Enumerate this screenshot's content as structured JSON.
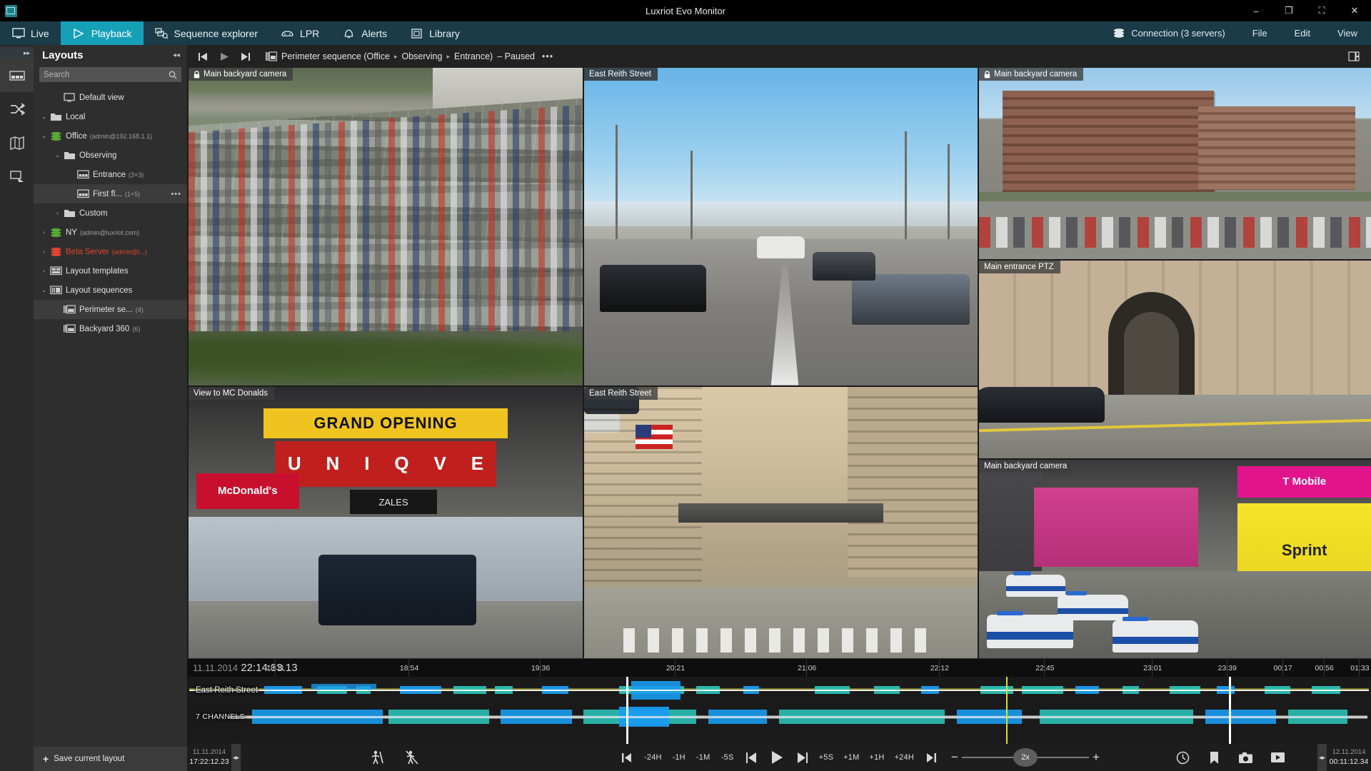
{
  "window": {
    "title": "Luxriot Evo Monitor",
    "app_icon": "monitor-icon",
    "minimize": "–",
    "restore": "❐",
    "maximize": "⛶",
    "close": "✕"
  },
  "menubar": {
    "tabs": [
      {
        "label": "Live",
        "icon": "monitor-icon",
        "active": false
      },
      {
        "label": "Playback",
        "icon": "play-triangle-icon",
        "active": true
      },
      {
        "label": "Sequence explorer",
        "icon": "sequence-icon",
        "active": false
      },
      {
        "label": "LPR",
        "icon": "car-plate-icon",
        "active": false
      },
      {
        "label": "Alerts",
        "icon": "bell-icon",
        "active": false
      },
      {
        "label": "Library",
        "icon": "library-icon",
        "active": false
      }
    ],
    "right": [
      {
        "label": "Connection (3 servers)",
        "icon": "database-stack-icon"
      },
      {
        "label": "File",
        "icon": ""
      },
      {
        "label": "Edit",
        "icon": ""
      },
      {
        "label": "View",
        "icon": ""
      }
    ]
  },
  "rail": {
    "collapse": "▸▸",
    "items": [
      {
        "name": "layouts-icon",
        "selected": true
      },
      {
        "name": "sequences-icon",
        "selected": false
      },
      {
        "name": "maps-icon",
        "selected": false
      },
      {
        "name": "screens-icon",
        "selected": false
      }
    ]
  },
  "layouts_panel": {
    "title": "Layouts",
    "collapse_icon": "◂◂",
    "search": {
      "placeholder": "Search",
      "value": "",
      "icon": "search-icon"
    },
    "save_button": {
      "label": "Save current layout",
      "plus": "+"
    },
    "tree": [
      {
        "indent": 1,
        "arrow": "",
        "icon": "monitor-icon",
        "label": "Default view",
        "sub": "",
        "selected": false,
        "red": false,
        "dots": false
      },
      {
        "indent": 0,
        "arrow": "⌄",
        "icon": "folder-icon",
        "label": "Local",
        "sub": "",
        "selected": false,
        "red": false,
        "dots": false
      },
      {
        "indent": 0,
        "arrow": "⌄",
        "icon": "server-green-icon",
        "label": "Office",
        "sub": "(admin@192.168.1.1)",
        "selected": false,
        "red": false,
        "dots": false
      },
      {
        "indent": 1,
        "arrow": "⌄",
        "icon": "folder-icon",
        "label": "Observing",
        "sub": "",
        "selected": false,
        "red": false,
        "dots": false
      },
      {
        "indent": 2,
        "arrow": "",
        "icon": "layout-icon",
        "label": "Entrance",
        "sub": "(3×3)",
        "selected": false,
        "red": false,
        "dots": false
      },
      {
        "indent": 2,
        "arrow": "",
        "icon": "layout-icon",
        "label": "First fl...",
        "sub": "(1+5)",
        "selected": true,
        "red": false,
        "dots": true
      },
      {
        "indent": 1,
        "arrow": "›",
        "icon": "folder-icon",
        "label": "Custom",
        "sub": "",
        "selected": false,
        "red": false,
        "dots": false
      },
      {
        "indent": 0,
        "arrow": "›",
        "icon": "server-green-icon",
        "label": "NY",
        "sub": "(admin@luxriot.com)",
        "selected": false,
        "red": false,
        "dots": false
      },
      {
        "indent": 0,
        "arrow": "›",
        "icon": "server-red-icon",
        "label": "Beta Server",
        "sub": "(admin@l...)",
        "selected": false,
        "red": true,
        "dots": false
      },
      {
        "indent": 0,
        "arrow": "›",
        "icon": "template-icon",
        "label": "Layout templates",
        "sub": "",
        "selected": false,
        "red": false,
        "dots": false
      },
      {
        "indent": 0,
        "arrow": "⌄",
        "icon": "sequence-list-icon",
        "label": "Layout sequences",
        "sub": "",
        "selected": false,
        "red": false,
        "dots": false
      },
      {
        "indent": 1,
        "arrow": "",
        "icon": "seq-item-icon",
        "label": "Perimeter se...",
        "sub": "(4)",
        "selected": true,
        "red": false,
        "dots": false
      },
      {
        "indent": 1,
        "arrow": "",
        "icon": "seq-item-icon",
        "label": "Backyard 360",
        "sub": "(6)",
        "selected": false,
        "red": false,
        "dots": false
      }
    ]
  },
  "toolbar": {
    "prev_icon": "skip-previous-icon",
    "play_icon": "play-icon",
    "next_icon": "skip-next-icon",
    "breadcrumb": {
      "icon": "sequence-layout-icon",
      "root": "Perimeter sequence (Office",
      "sep": "▸",
      "parts": [
        "Observing",
        "Entrance)"
      ],
      "state": "– Paused",
      "overflow": "•••"
    },
    "right_icon": "grid-expand-icon"
  },
  "cells": [
    {
      "title": "Main backyard camera",
      "locked": true,
      "selected": false,
      "scene": "parking"
    },
    {
      "title": "View to MC Donalds",
      "locked": false,
      "selected": false,
      "scene": "mcd"
    },
    {
      "title": "East Reith Street",
      "locked": false,
      "selected": true,
      "scene": "street"
    },
    {
      "title": "East Reith Street",
      "locked": false,
      "selected": false,
      "scene": "city"
    },
    {
      "title": "Main backyard camera",
      "locked": true,
      "selected": false,
      "scene": "office"
    },
    {
      "title": "Main entrance PTZ",
      "locked": false,
      "selected": false,
      "scene": "arch"
    },
    {
      "title": "Main backyard camera",
      "locked": false,
      "selected": false,
      "scene": "mall"
    }
  ],
  "timeline": {
    "current_date": "11.11.2014",
    "current_time": "22:14:33.13",
    "ticks": [
      "18:11",
      "18:54",
      "19:36",
      "20:21",
      "21:06",
      "22:12",
      "22:45",
      "23:01",
      "23:39",
      "00:17",
      "00:56",
      "01:33"
    ],
    "tracks": [
      {
        "name": "East Reith Street",
        "small": false
      },
      {
        "name": "7 CHANNELS",
        "small": true
      }
    ],
    "colors": {
      "archive": "#1a9cf0",
      "motion": "#2bc0b6",
      "audio": "#8c8a2a",
      "playhead": "#d9e021",
      "now": "#ffffff"
    }
  },
  "bottom": {
    "left_timestamp": {
      "date": "11.11.2014",
      "time": "17:22:12.23"
    },
    "right_timestamp": {
      "date": "12.11.2014",
      "time": "00:11:12.34"
    },
    "grip_icon": "drag-handle-icon",
    "filters": [
      {
        "name": "motion-filter-icon"
      },
      {
        "name": "motion-filter-off-icon"
      }
    ],
    "transport": [
      {
        "label": "",
        "icon": "jump-start-icon"
      },
      {
        "label": "-24H",
        "icon": ""
      },
      {
        "label": "-1H",
        "icon": ""
      },
      {
        "label": "-1M",
        "icon": ""
      },
      {
        "label": "-5S",
        "icon": ""
      },
      {
        "label": "",
        "icon": "step-back-icon"
      },
      {
        "label": "",
        "icon": "play-big-icon"
      },
      {
        "label": "",
        "icon": "step-forward-icon"
      },
      {
        "label": "+5S",
        "icon": ""
      },
      {
        "label": "+1M",
        "icon": ""
      },
      {
        "label": "+1H",
        "icon": ""
      },
      {
        "label": "+24H",
        "icon": ""
      },
      {
        "label": "",
        "icon": "jump-end-icon"
      }
    ],
    "speed": {
      "minus": "−",
      "plus": "+",
      "value": "2x"
    },
    "actions": [
      {
        "name": "clock-icon"
      },
      {
        "name": "bookmark-icon"
      },
      {
        "name": "snapshot-icon"
      },
      {
        "name": "export-video-icon"
      }
    ]
  }
}
